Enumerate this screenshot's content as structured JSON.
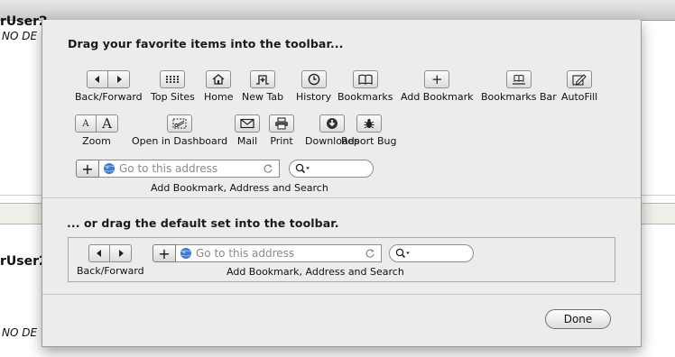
{
  "background": {
    "user_name_1": "rUser2",
    "status_1": "NO DE",
    "user_name_2": "rUser2",
    "status_2": "NO DE"
  },
  "sheet": {
    "heading_favorites": "Drag your favorite items into the toolbar...",
    "heading_default": "... or drag the default set into the toolbar.",
    "items": {
      "back_forward": "Back/Forward",
      "top_sites": "Top Sites",
      "home": "Home",
      "new_tab": "New Tab",
      "history": "History",
      "bookmarks": "Bookmarks",
      "add_bookmark": "Add Bookmark",
      "bookmarks_bar": "Bookmarks Bar",
      "autofill": "AutoFill",
      "zoom": "Zoom",
      "open_in_dashboard": "Open in Dashboard",
      "mail": "Mail",
      "print": "Print",
      "downloads": "Downloads",
      "report_bug": "Report Bug"
    },
    "zoom_small": "A",
    "zoom_large": "A",
    "add_bookmark_glyph": "+",
    "address_placeholder": "Go to this address",
    "address_group_label": "Add Bookmark, Address and Search",
    "default_back_forward_label": "Back/Forward",
    "default_address_placeholder": "Go to this address",
    "default_group_label": "Add Bookmark, Address and Search",
    "done_label": "Done"
  }
}
